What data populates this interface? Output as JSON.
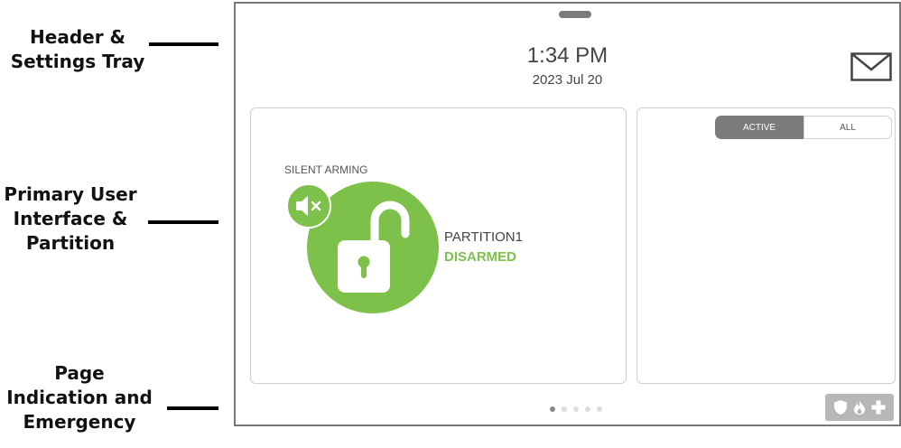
{
  "annotations": [
    {
      "id": "header",
      "lines": [
        "Header &",
        "Settings Tray"
      ]
    },
    {
      "id": "primary",
      "lines": [
        "Primary User",
        "Interface &",
        "Partition"
      ]
    },
    {
      "id": "page",
      "lines": [
        "Page",
        "Indication and",
        "Emergency"
      ]
    }
  ],
  "header": {
    "time": "1:34 PM",
    "date": "2023 Jul 20",
    "messages_icon": "envelope-icon"
  },
  "main": {
    "silent_arming_label": "SILENT ARMING",
    "partition_name": "PARTITION1",
    "partition_status": "DISARMED",
    "lock_icon": "unlocked-padlock-icon",
    "silent_icon": "speaker-muted-icon"
  },
  "events_panel": {
    "tabs": [
      {
        "label": "ACTIVE",
        "selected": true
      },
      {
        "label": "ALL",
        "selected": false
      }
    ]
  },
  "footer": {
    "page_count": 5,
    "current_page": 1,
    "emergency_icons": [
      "shield-icon",
      "fire-icon",
      "medical-cross-icon"
    ]
  },
  "colors": {
    "accent_green": "#7dc04a",
    "tab_active": "#7c7c7c",
    "emergency_button": "#b7b7b7"
  }
}
